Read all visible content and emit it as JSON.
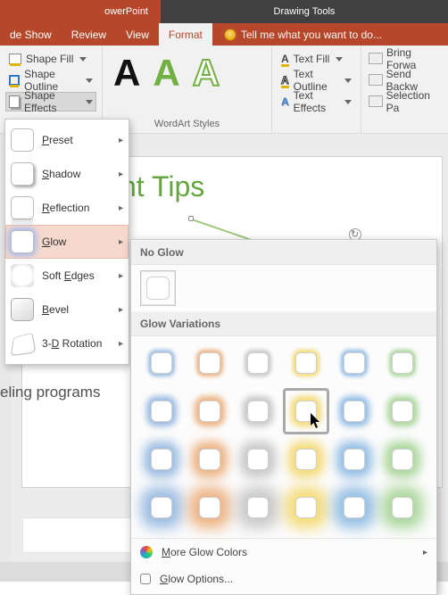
{
  "titlebar": {
    "app": "owerPoint",
    "context": "Drawing Tools"
  },
  "tabs": {
    "items": [
      "de Show",
      "Review",
      "View",
      "Format"
    ],
    "active": "Format",
    "tellme": "Tell me what you want to do..."
  },
  "ribbon": {
    "shape": {
      "fill": "Shape Fill",
      "outline": "Shape Outline",
      "effects": "Shape Effects"
    },
    "wordart_group": "WordArt Styles",
    "text": {
      "fill": "Text Fill",
      "outline": "Text Outline",
      "effects": "Text Effects"
    },
    "arrange": {
      "bringfw": "Bring Forwa",
      "sendbw": "Send Backw",
      "selpane": "Selection Pa"
    }
  },
  "effects_menu": {
    "items": [
      {
        "label_pre": "",
        "u": "P",
        "label_post": "reset"
      },
      {
        "label_pre": "",
        "u": "S",
        "label_post": "hadow"
      },
      {
        "label_pre": "",
        "u": "R",
        "label_post": "eflection"
      },
      {
        "label_pre": "",
        "u": "G",
        "label_post": "low"
      },
      {
        "label_pre": "Soft ",
        "u": "E",
        "label_post": "dges"
      },
      {
        "label_pre": "",
        "u": "B",
        "label_post": "evel"
      },
      {
        "label_pre": "3-",
        "u": "D",
        "label_post": " Rotation"
      }
    ]
  },
  "glow_panel": {
    "noglow_head": "No Glow",
    "variations_head": "Glow Variations",
    "colors": [
      "#7aa6d8",
      "#e79a5a",
      "#b7b7b7",
      "#f2cf4a",
      "#6fa8dc",
      "#8fc97a"
    ],
    "rows_blur": [
      4,
      7,
      11,
      15
    ],
    "more_colors": "More Glow Colors",
    "options": "Glow Options..."
  },
  "slide": {
    "title": "nt Tips",
    "body": "eling programs"
  }
}
